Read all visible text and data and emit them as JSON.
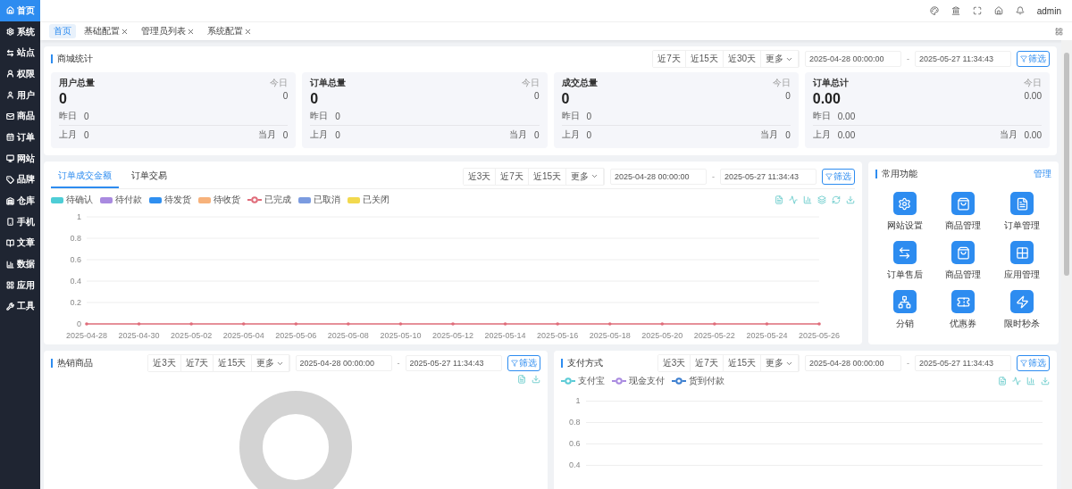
{
  "sidebar": {
    "items": [
      {
        "label": "首页",
        "selected": true
      },
      {
        "label": "系统",
        "selected": false
      },
      {
        "label": "站点",
        "selected": false
      },
      {
        "label": "权限",
        "selected": false
      },
      {
        "label": "用户",
        "selected": false
      },
      {
        "label": "商品",
        "selected": false
      },
      {
        "label": "订单",
        "selected": false
      },
      {
        "label": "网站",
        "selected": false
      },
      {
        "label": "品牌",
        "selected": false
      },
      {
        "label": "仓库",
        "selected": false
      },
      {
        "label": "手机",
        "selected": false
      },
      {
        "label": "文章",
        "selected": false
      },
      {
        "label": "数据",
        "selected": false
      },
      {
        "label": "应用",
        "selected": false
      },
      {
        "label": "工具",
        "selected": false
      }
    ]
  },
  "header": {
    "user": "admin"
  },
  "tabs": [
    {
      "label": "首页",
      "selected": true,
      "closable": false
    },
    {
      "label": "基础配置",
      "selected": false,
      "closable": true
    },
    {
      "label": "管理员列表",
      "selected": false,
      "closable": true
    },
    {
      "label": "系统配置",
      "selected": false,
      "closable": true
    }
  ],
  "mall_stats": {
    "title": "商城统计",
    "filter": {
      "ranges": [
        "近7天",
        "近15天",
        "近30天"
      ],
      "more": "更多",
      "start": "2025-04-28 00:00:00",
      "separator": "-",
      "end": "2025-05-27 11:34:43",
      "button": "筛选"
    },
    "cards": [
      {
        "title": "用户总量",
        "value": "0",
        "today_label": "今日",
        "today": "0",
        "yesterday_label": "昨日",
        "yesterday": "0",
        "last_month_label": "上月",
        "last_month": "0",
        "this_month_label": "当月",
        "this_month": "0"
      },
      {
        "title": "订单总量",
        "value": "0",
        "today_label": "今日",
        "today": "0",
        "yesterday_label": "昨日",
        "yesterday": "0",
        "last_month_label": "上月",
        "last_month": "0",
        "this_month_label": "当月",
        "this_month": "0"
      },
      {
        "title": "成交总量",
        "value": "0",
        "today_label": "今日",
        "today": "0",
        "yesterday_label": "昨日",
        "yesterday": "0",
        "last_month_label": "上月",
        "last_month": "0",
        "this_month_label": "当月",
        "this_month": "0"
      },
      {
        "title": "订单总计",
        "value": "0.00",
        "today_label": "今日",
        "today": "0.00",
        "yesterday_label": "昨日",
        "yesterday": "0.00",
        "last_month_label": "上月",
        "last_month": "0.00",
        "this_month_label": "当月",
        "this_month": "0.00"
      }
    ]
  },
  "order_chart": {
    "tabs": [
      {
        "label": "订单成交金额",
        "selected": true
      },
      {
        "label": "订单交易",
        "selected": false
      }
    ],
    "filter": {
      "ranges": [
        "近3天",
        "近7天",
        "近15天"
      ],
      "more": "更多",
      "start": "2025-04-28 00:00:00",
      "separator": "-",
      "end": "2025-05-27 11:34:43",
      "button": "筛选"
    },
    "legend": [
      {
        "label": "待确认",
        "color": "#4ecdd6",
        "kind": "swatch"
      },
      {
        "label": "待付款",
        "color": "#a98ae0",
        "kind": "swatch"
      },
      {
        "label": "待发货",
        "color": "#2f8ff0",
        "kind": "swatch"
      },
      {
        "label": "待收货",
        "color": "#f7b27b",
        "kind": "swatch"
      },
      {
        "label": "已完成",
        "color": "#e06c7a",
        "kind": "line"
      },
      {
        "label": "已取消",
        "color": "#7b9be0",
        "kind": "swatch"
      },
      {
        "label": "已关闭",
        "color": "#f2d94e",
        "kind": "swatch"
      }
    ],
    "chart_data": {
      "type": "line",
      "categories": [
        "2025-04-28",
        "2025-04-30",
        "2025-05-02",
        "2025-05-04",
        "2025-05-06",
        "2025-05-08",
        "2025-05-10",
        "2025-05-12",
        "2025-05-14",
        "2025-05-16",
        "2025-05-18",
        "2025-05-20",
        "2025-05-22",
        "2025-05-24",
        "2025-05-26"
      ],
      "ylim": [
        0,
        1
      ],
      "yticks": [
        0,
        0.2,
        0.4,
        0.6,
        0.8,
        1
      ],
      "grid": true,
      "series": [
        {
          "color": "#e06c7a",
          "values": [
            0,
            0,
            0,
            0,
            0,
            0,
            0,
            0,
            0,
            0,
            0,
            0,
            0,
            0,
            0
          ]
        }
      ]
    }
  },
  "quick": {
    "title": "常用功能",
    "manage": "管理",
    "items": [
      {
        "label": "网站设置"
      },
      {
        "label": "商品管理"
      },
      {
        "label": "订单管理"
      },
      {
        "label": "订单售后"
      },
      {
        "label": "商品管理"
      },
      {
        "label": "应用管理"
      },
      {
        "label": "分销"
      },
      {
        "label": "优惠券"
      },
      {
        "label": "限时秒杀"
      }
    ]
  },
  "hot_products": {
    "title": "热销商品",
    "filter": {
      "ranges": [
        "近3天",
        "近7天",
        "近15天"
      ],
      "more": "更多",
      "start": "2025-04-28 00:00:00",
      "separator": "-",
      "end": "2025-05-27 11:34:43",
      "button": "筛选"
    }
  },
  "payment": {
    "title": "支付方式",
    "filter": {
      "ranges": [
        "近3天",
        "近7天",
        "近15天"
      ],
      "more": "更多",
      "start": "2025-04-28 00:00:00",
      "separator": "-",
      "end": "2025-05-27 11:34:43",
      "button": "筛选"
    },
    "legend": [
      {
        "label": "支付宝",
        "color": "#5ccbd6"
      },
      {
        "label": "现金支付",
        "color": "#a98ae0"
      },
      {
        "label": "货到付款",
        "color": "#3d7fd0"
      }
    ],
    "axis_labels": [
      "1",
      "0.8",
      "0.6",
      "0.4"
    ]
  }
}
